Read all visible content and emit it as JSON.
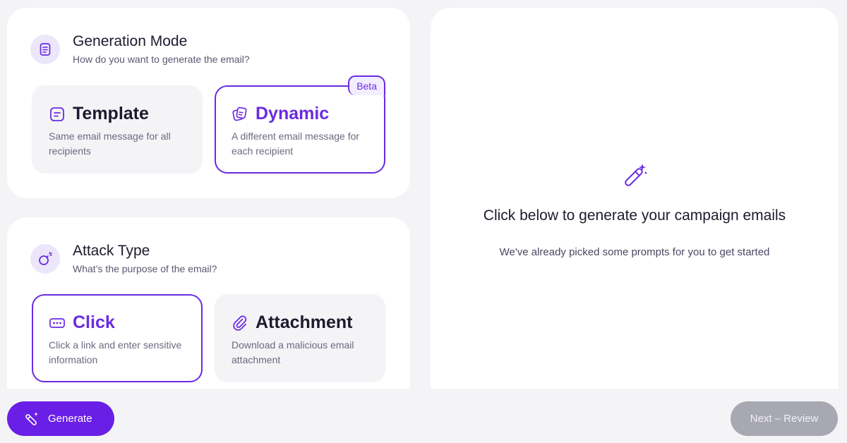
{
  "generation_mode": {
    "title": "Generation Mode",
    "subtitle": "How do you want to generate the email?",
    "icon": "document-icon",
    "options": [
      {
        "label": "Template",
        "description": "Same email message for all recipients",
        "icon": "template-icon",
        "selected": false
      },
      {
        "label": "Dynamic",
        "description": "A different email message for each recipient",
        "icon": "dynamic-icon",
        "selected": true,
        "badge": "Beta"
      }
    ]
  },
  "attack_type": {
    "title": "Attack Type",
    "subtitle": "What’s the purpose of the email?",
    "icon": "bomb-icon",
    "options": [
      {
        "label": "Click",
        "description": "Click a link and enter sensitive information",
        "icon": "password-icon",
        "selected": true
      },
      {
        "label": "Attachment",
        "description": "Download a malicious email attachment",
        "icon": "paperclip-icon",
        "selected": false
      }
    ]
  },
  "preview": {
    "icon": "magic-wand-icon",
    "title": "Click below to generate your campaign emails",
    "subtitle": "We've already picked some prompts for you to get started"
  },
  "footer": {
    "generate_label": "Generate",
    "next_label": "Next – Review"
  },
  "colors": {
    "accent": "#6a2ce0",
    "accent_button": "#6a1fe6",
    "disabled_button": "#a8a8b3",
    "background": "#f4f4f7",
    "icon_circle": "#ece6fb"
  }
}
